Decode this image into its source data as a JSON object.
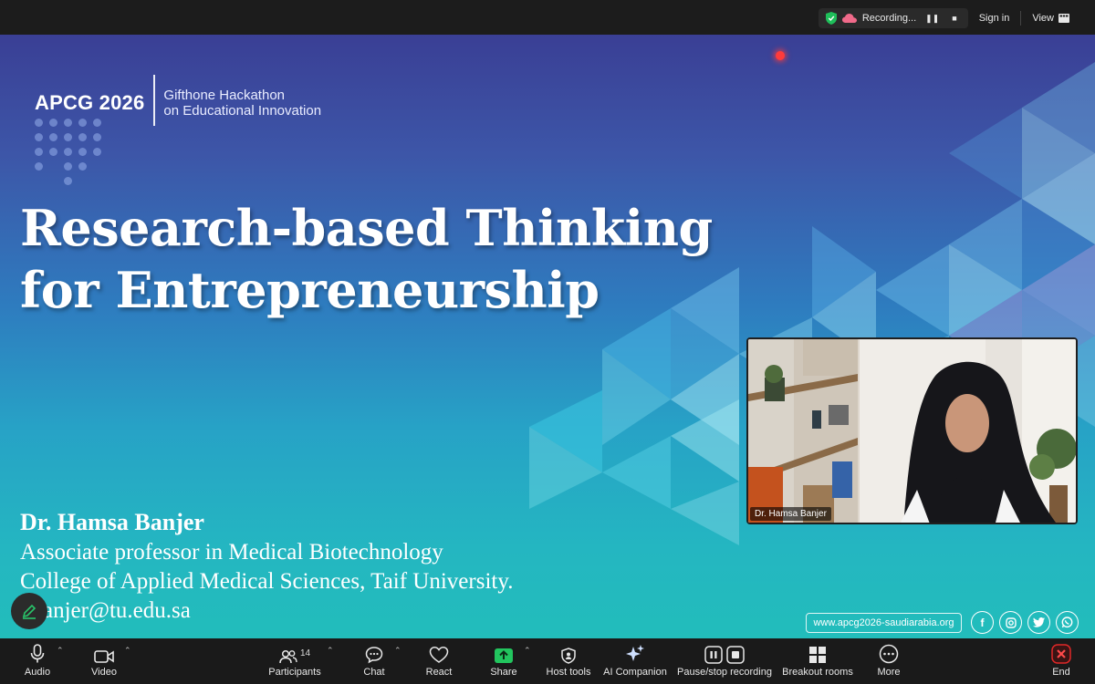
{
  "topbar": {
    "recording_label": "Recording...",
    "sign_in": "Sign in",
    "view": "View"
  },
  "slide": {
    "brand_main": "APCG 2026",
    "brand_sub_1": "Gifthone Hackathon",
    "brand_sub_2": "on Educational Innovation",
    "title_line1": "Research-based Thinking",
    "title_line2": "for Entrepreneurship",
    "presenter_name": "Dr. Hamsa Banjer",
    "presenter_role": "Associate professor in Medical Biotechnology",
    "presenter_org": "College of Applied Medical Sciences, Taif University.",
    "presenter_email": "hbanjer@tu.edu.sa",
    "website": "www.apcg2026-saudiarabia.org",
    "socials": [
      "facebook-icon",
      "instagram-icon",
      "twitter-icon",
      "whatsapp-icon"
    ]
  },
  "video": {
    "participant_name": "Dr. Hamsa Banjer"
  },
  "toolbar": {
    "audio": "Audio",
    "video": "Video",
    "participants": "Participants",
    "participants_count": "14",
    "chat": "Chat",
    "react": "React",
    "share": "Share",
    "host_tools": "Host tools",
    "ai_companion": "AI Companion",
    "pause_recording": "Pause/stop recording",
    "breakout_rooms": "Breakout rooms",
    "more": "More",
    "end": "End"
  },
  "colors": {
    "share_green": "#22c55e",
    "end_red": "#e02828",
    "shield_green": "#1fbf5a",
    "record_dot": "#ff3b3b"
  }
}
